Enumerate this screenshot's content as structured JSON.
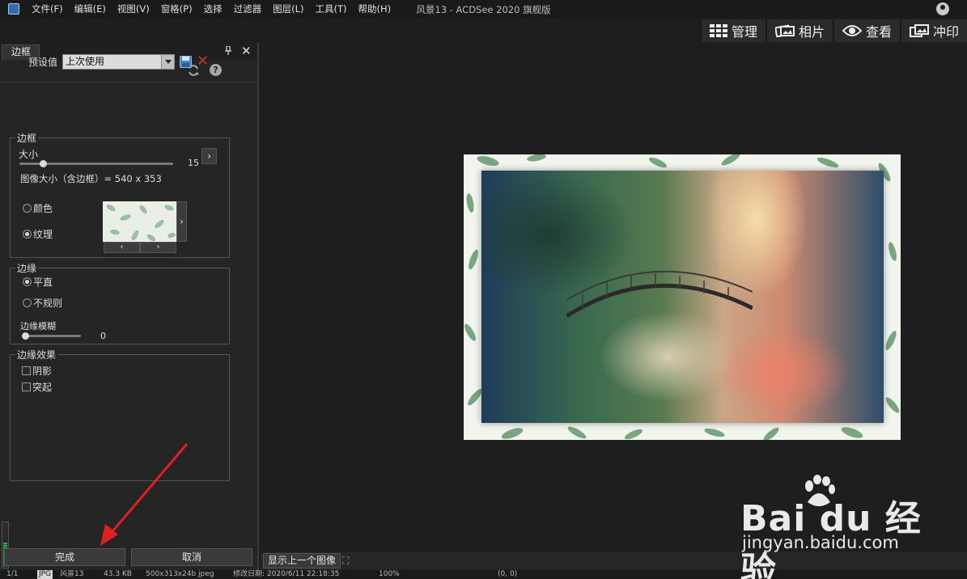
{
  "menu": {
    "items": [
      "文件(F)",
      "编辑(E)",
      "视图(V)",
      "窗格(P)",
      "选择",
      "过滤器",
      "图层(L)",
      "工具(T)",
      "帮助(H)"
    ],
    "window_title": "风景13 - ACDSee 2020 旗舰版"
  },
  "modes": [
    {
      "label": "管理",
      "icon": "grid-icon"
    },
    {
      "label": "相片",
      "icon": "photos-icon"
    },
    {
      "label": "查看",
      "icon": "eye-icon"
    },
    {
      "label": "冲印",
      "icon": "develop-icon"
    }
  ],
  "panel": {
    "tab": "边框",
    "preset_label": "预设值",
    "preset_value": "上次使用",
    "border_group": "边框",
    "size_label": "大小",
    "size_value": "15",
    "size_fraction": 0.15,
    "image_size_text": "图像大小（含边框）= 540 x 353",
    "color_label": "颜色",
    "texture_label": "纹理",
    "edge_group": "边缘",
    "edge_straight": "平直",
    "edge_irregular": "不规则",
    "edge_blur_label": "边缘模糊",
    "edge_blur_value": "0",
    "effects_group": "边缘效果",
    "shadow_label": "阴影",
    "raised_label": "突起",
    "done_button": "完成",
    "cancel_button": "取消"
  },
  "viewer": {
    "prev_image_button": "显示上一个图像"
  },
  "status": {
    "index": "1/1",
    "format": "JPG",
    "filename": "风景13",
    "filesize": "43.3 KB",
    "dims": "500x313x24b jpeg",
    "modified": "修改日期: 2020/6/11 22:18:35",
    "zoom": "100%",
    "coords": "(0, 0)"
  },
  "watermark": {
    "brand": "Bai du 经验",
    "site": "jingyan.baidu.com"
  }
}
